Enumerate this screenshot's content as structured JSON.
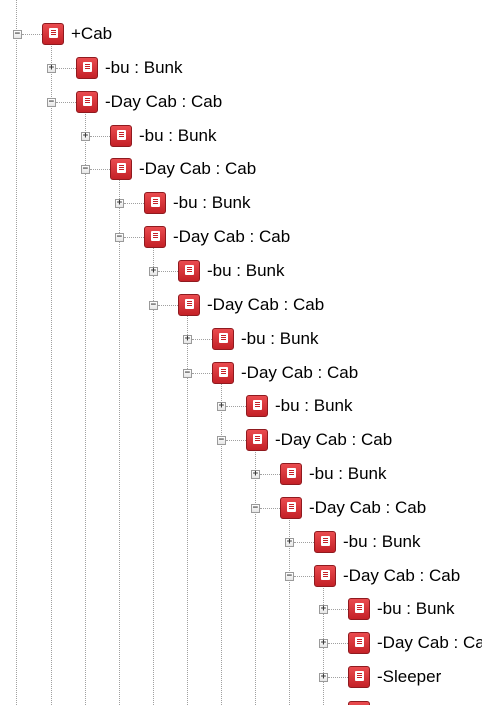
{
  "tree": {
    "root_label": "+Cab",
    "bunk_label": "-bu : Bunk",
    "daycab_label": "-Day Cab : Cab",
    "sleeper_label": "-Sleeper",
    "icon": "part-icon",
    "expander_collapsed_glyph": "+",
    "expander_expanded_glyph": "−",
    "accent_color": "#c42127"
  }
}
